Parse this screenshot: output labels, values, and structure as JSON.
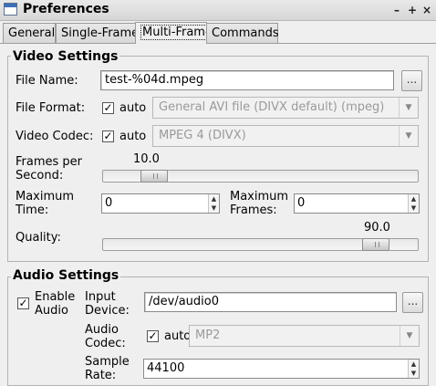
{
  "window": {
    "title": "Preferences",
    "controls": [
      "–",
      "+",
      "×"
    ]
  },
  "tabs": [
    {
      "label": "General",
      "active": false
    },
    {
      "label": "Single-Frame",
      "active": false
    },
    {
      "label": "Multi-Frame",
      "active": true
    },
    {
      "label": "Commands",
      "active": false
    }
  ],
  "video": {
    "group_title": "Video Settings",
    "file_name_label": "File Name:",
    "file_name_value": "test-%04d.mpeg",
    "browse_label": "...",
    "file_format_label": "File Format:",
    "file_format_auto_label": "auto",
    "file_format_auto_checked": true,
    "file_format_value": "General AVI file (DIVX default) (mpeg)",
    "video_codec_label": "Video Codec:",
    "video_codec_auto_label": "auto",
    "video_codec_auto_checked": true,
    "video_codec_value": "MPEG 4 (DIVX)",
    "fps_label_line1": "Frames per",
    "fps_label_line2": "Second:",
    "fps_value": "10.0",
    "fps_fraction": 0.13,
    "max_time_label_line1": "Maximum",
    "max_time_label_line2": "Time:",
    "max_time_value": "0",
    "max_frames_label_line1": "Maximum",
    "max_frames_label_line2": "Frames:",
    "max_frames_value": "0",
    "quality_label": "Quality:",
    "quality_value": "90.0",
    "quality_fraction": 0.9
  },
  "audio": {
    "group_title": "Audio Settings",
    "enable_label_line1": "Enable",
    "enable_label_line2": "Audio",
    "enable_checked": true,
    "input_device_label_line1": "Input",
    "input_device_label_line2": "Device:",
    "input_device_value": "/dev/audio0",
    "browse_label": "...",
    "audio_codec_label_line1": "Audio",
    "audio_codec_label_line2": "Codec:",
    "audio_codec_auto_label": "auto",
    "audio_codec_auto_checked": true,
    "audio_codec_value": "MP2",
    "sample_rate_label_line1": "Sample",
    "sample_rate_label_line2": "Rate:",
    "sample_rate_value": "44100"
  },
  "icons": {
    "check": "✓",
    "combo_arrow": "▼",
    "spin_up": "▲",
    "spin_down": "▼"
  }
}
